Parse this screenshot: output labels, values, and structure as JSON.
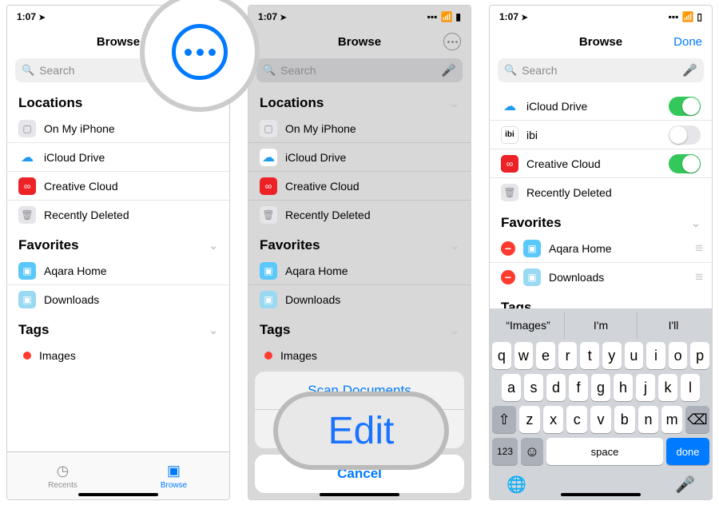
{
  "status": {
    "time": "1:07",
    "loc_arrow": "➤"
  },
  "nav": {
    "title": "Browse",
    "done": "Done"
  },
  "search": {
    "placeholder": "Search"
  },
  "sections": {
    "locations": "Locations",
    "favorites": "Favorites",
    "tags": "Tags"
  },
  "locations_p1": [
    {
      "label": "On My iPhone",
      "icon": "phone"
    },
    {
      "label": "iCloud Drive",
      "icon": "cloud"
    },
    {
      "label": "Creative Cloud",
      "icon": "cc"
    },
    {
      "label": "Recently Deleted",
      "icon": "trash"
    }
  ],
  "locations_p3": [
    {
      "label": "iCloud Drive",
      "icon": "cloud",
      "toggle": "on"
    },
    {
      "label": "ibi",
      "icon": "ibi",
      "toggle": "off"
    },
    {
      "label": "Creative Cloud",
      "icon": "cc",
      "toggle": "on"
    },
    {
      "label": "Recently Deleted",
      "icon": "trash",
      "toggle": null
    }
  ],
  "favorites": [
    {
      "label": "Aqara Home",
      "icon": "folder"
    },
    {
      "label": "Downloads",
      "icon": "folder2"
    }
  ],
  "tags": [
    {
      "label": "Images"
    }
  ],
  "tags_editing": {
    "value": "Images"
  },
  "action_sheet": {
    "scan": "Scan Documents",
    "edit": "Edit",
    "cancel": "Cancel"
  },
  "tabs": {
    "recents": "Recents",
    "browse": "Browse"
  },
  "callout_edit": "Edit",
  "keyboard": {
    "suggestions": [
      "“Images”",
      "I'm",
      "I'll"
    ],
    "row1": [
      "q",
      "w",
      "e",
      "r",
      "t",
      "y",
      "u",
      "i",
      "o",
      "p"
    ],
    "row2": [
      "a",
      "s",
      "d",
      "f",
      "g",
      "h",
      "j",
      "k",
      "l"
    ],
    "row3": [
      "z",
      "x",
      "c",
      "v",
      "b",
      "n",
      "m"
    ],
    "shift": "⇧",
    "backspace": "⌫",
    "numbers": "123",
    "emoji": "☺",
    "space": "space",
    "done": "done",
    "globe": "🌐",
    "mic": "🎤"
  }
}
